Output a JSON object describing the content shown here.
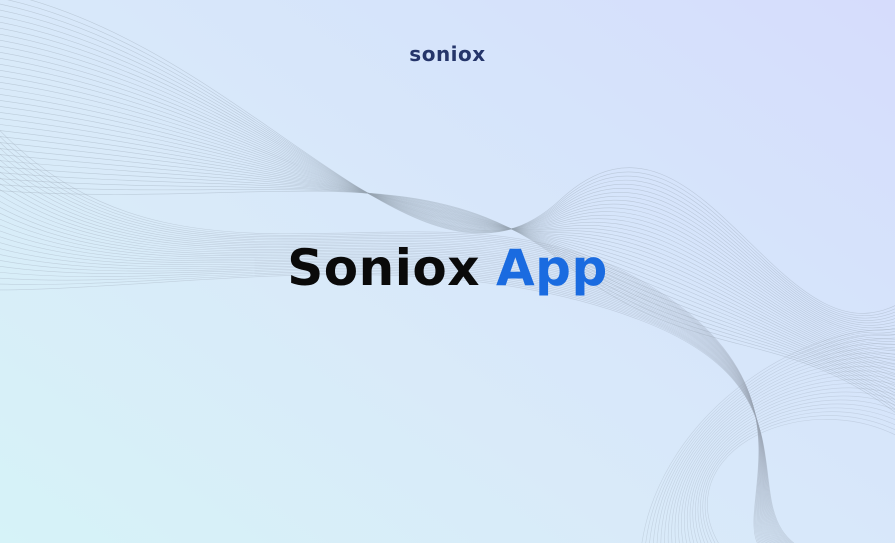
{
  "brand": {
    "logo_text": "soniox",
    "logo_color": "#25356a"
  },
  "hero": {
    "word_primary": "Soniox",
    "word_accent": "App",
    "accent_color": "#1a6be0"
  },
  "background": {
    "gradient_start": "#d6f3f8",
    "gradient_end": "#d6dcfc",
    "wave_line_color": "#9aa6b4"
  }
}
